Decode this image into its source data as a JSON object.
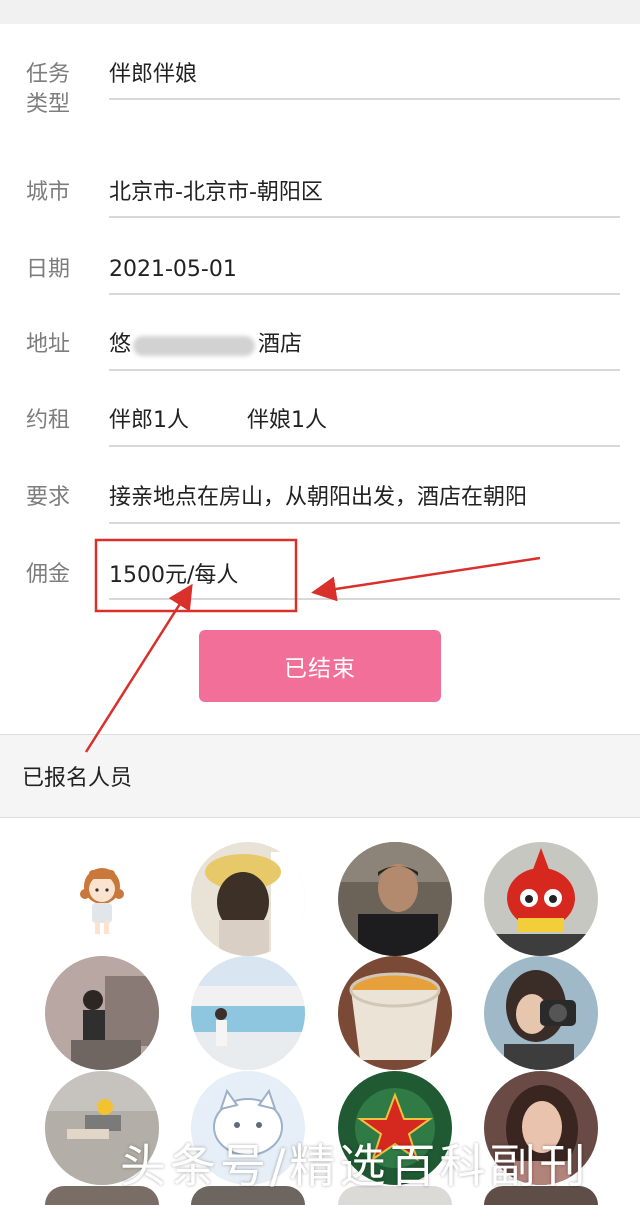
{
  "form": {
    "task_type": {
      "label": "任务\n类型",
      "value": "伴郎伴娘"
    },
    "city": {
      "label": "城市",
      "value": "北京市-北京市-朝阳区"
    },
    "date": {
      "label": "日期",
      "value": "2021-05-01"
    },
    "address": {
      "label": "地址",
      "value_prefix": "悠",
      "value_suffix": "酒店"
    },
    "hire": {
      "label": "约租",
      "value_groomsman": "伴郎1人",
      "value_bridesmaid": "伴娘1人"
    },
    "requirement": {
      "label": "要求",
      "value": "接亲地点在房山，从朝阳出发，酒店在朝阳"
    },
    "commission": {
      "label": "佣金",
      "value": "1500元/每人"
    }
  },
  "status_button": {
    "label": "已结束"
  },
  "registered_section": {
    "title": "已报名人员"
  },
  "avatars": [
    {
      "name": "cartoon-girl-avatar"
    },
    {
      "name": "hat-girl-avatar"
    },
    {
      "name": "man-avatar"
    },
    {
      "name": "red-toy-avatar"
    },
    {
      "name": "sitting-girl-avatar"
    },
    {
      "name": "pool-girl-avatar"
    },
    {
      "name": "teacup-avatar"
    },
    {
      "name": "camera-girl-avatar"
    },
    {
      "name": "street-avatar"
    },
    {
      "name": "cartoon-cat-avatar"
    },
    {
      "name": "red-star-avatar"
    },
    {
      "name": "portrait-girl-avatar"
    }
  ],
  "watermark": {
    "text": "头条号/精选百科副刊"
  },
  "colors": {
    "accent": "#f26f9a",
    "annotation": "#d9302c",
    "label": "#7d7d7d"
  }
}
